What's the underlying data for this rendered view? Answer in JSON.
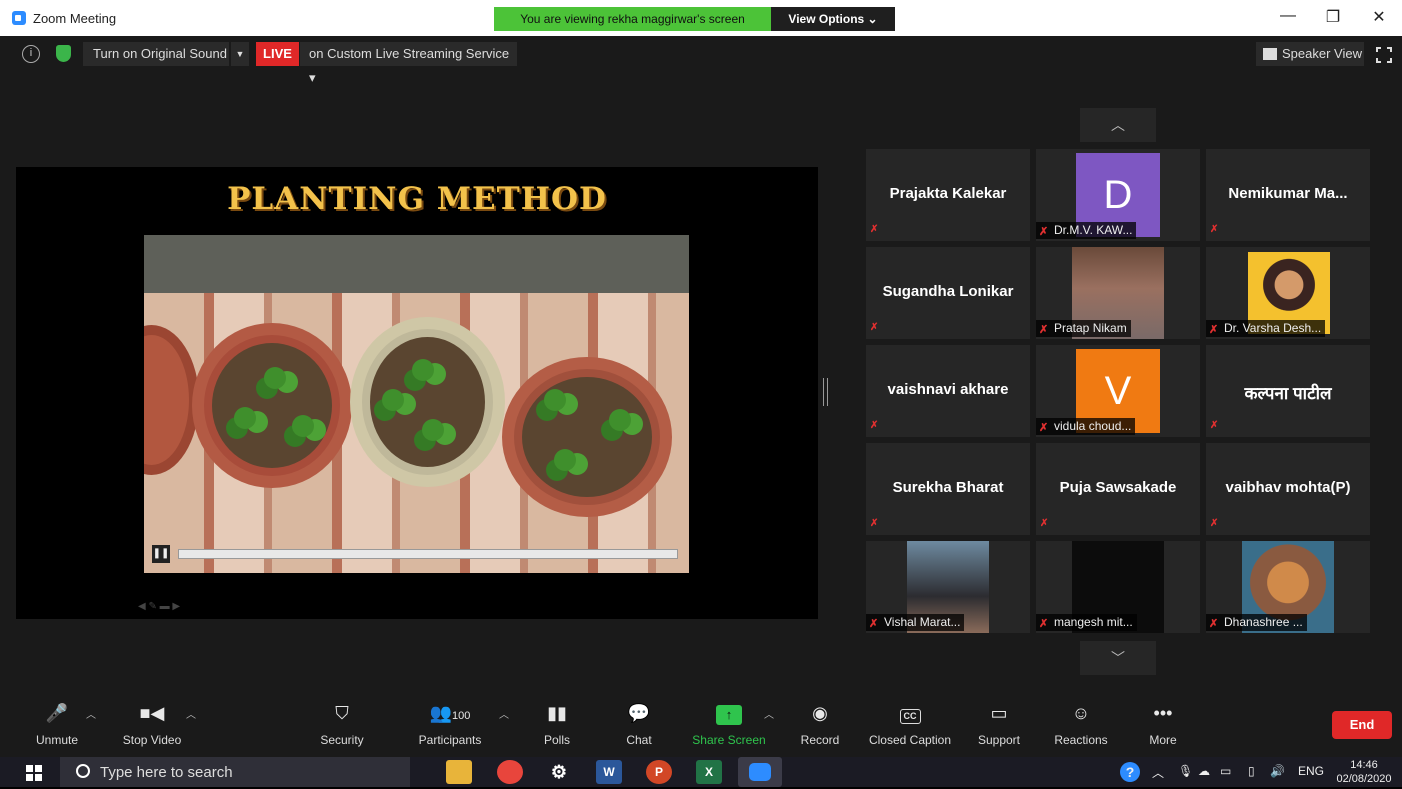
{
  "window": {
    "title": "Zoom Meeting",
    "banner": "You are viewing rekha maggirwar's screen",
    "view_options": "View Options ⌄",
    "minimize": "—",
    "restore": "❐",
    "close": "✕"
  },
  "meeting_bar": {
    "info": "i",
    "original_sound": "Turn on Original Sound",
    "live_badge": "LIVE",
    "live_service": "on Custom Live Streaming Service ▾",
    "speaker_view": "Speaker View"
  },
  "shared_screen": {
    "slide_title": "PLANTING METHOD"
  },
  "gallery": {
    "tiles": [
      {
        "name": "Prajakta Kalekar",
        "type": "name"
      },
      {
        "name": "Dr.M.V. KAW...",
        "type": "avatar",
        "initial": "D",
        "color": "#7e57c2"
      },
      {
        "name": "Nemikumar  Ma...",
        "type": "name"
      },
      {
        "name": "Sugandha Lonikar",
        "type": "name"
      },
      {
        "name": "Pratap Nikam",
        "type": "photo"
      },
      {
        "name": "Dr. Varsha Desh...",
        "type": "photo"
      },
      {
        "name": "vaishnavi akhare",
        "type": "name"
      },
      {
        "name": "vidula choud...",
        "type": "avatar",
        "initial": "V",
        "color": "#f07a12"
      },
      {
        "name": "कल्पना पाटील",
        "type": "name"
      },
      {
        "name": "Surekha Bharat",
        "type": "name"
      },
      {
        "name": "Puja Sawsakade",
        "type": "name"
      },
      {
        "name": "vaibhav mohta(P)",
        "type": "name"
      },
      {
        "name": "Vishal Marat...",
        "type": "photo"
      },
      {
        "name": "mangesh mit...",
        "type": "photo"
      },
      {
        "name": "Dhanashree ...",
        "type": "photo"
      }
    ]
  },
  "toolbar": {
    "unmute": "Unmute",
    "stop_video": "Stop Video",
    "security": "Security",
    "participants": "Participants",
    "participants_count": "100",
    "polls": "Polls",
    "chat": "Chat",
    "share_screen": "Share Screen",
    "record": "Record",
    "closed_caption": "Closed Caption",
    "support": "Support",
    "reactions": "Reactions",
    "more": "More",
    "end": "End",
    "cc_glyph": "CC"
  },
  "taskbar": {
    "search_placeholder": "Type here to search",
    "lang": "ENG",
    "time": "14:46",
    "date": "02/08/2020"
  }
}
